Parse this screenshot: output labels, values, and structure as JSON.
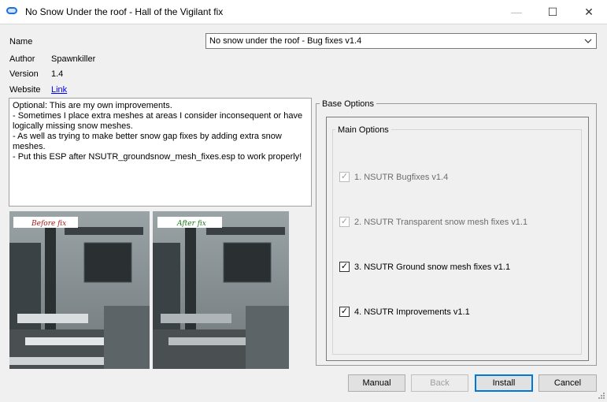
{
  "window": {
    "title": "No Snow Under the roof - Hall of the Vigilant fix",
    "minimize_glyph": "—",
    "maximize_glyph": "☐",
    "close_glyph": "✕"
  },
  "info": {
    "name_label": "Name",
    "name_value": "No snow under the roof - Bug fixes v1.4",
    "author_label": "Author",
    "author_value": "Spawnkiller",
    "version_label": "Version",
    "version_value": "1.4",
    "website_label": "Website",
    "website_link": "Link"
  },
  "description": "Optional: This are my own improvements.\n- Sometimes I place extra meshes at areas I consider inconsequent or have logically missing snow meshes.\n- As well as trying to make better snow gap fixes by adding extra snow meshes.\n- Put this ESP after NSUTR_groundsnow_mesh_fixes.esp to work properly!",
  "preview": {
    "before_label": "Before fix",
    "after_label": "After fix"
  },
  "base_options": {
    "title": "Base Options",
    "group_title": "Main Options",
    "items": [
      {
        "label": "1. NSUTR Bugfixes v1.4",
        "checked": true,
        "enabled": false
      },
      {
        "label": "2. NSUTR Transparent snow mesh fixes v1.1",
        "checked": true,
        "enabled": false
      },
      {
        "label": "3. NSUTR Ground snow mesh fixes v1.1",
        "checked": true,
        "enabled": true
      },
      {
        "label": "4. NSUTR Improvements v1.1",
        "checked": true,
        "enabled": true
      }
    ]
  },
  "buttons": {
    "manual": "Manual",
    "back": "Back",
    "install": "Install",
    "cancel": "Cancel"
  },
  "check_glyph": "✓",
  "chevron_glyph": "⌄"
}
